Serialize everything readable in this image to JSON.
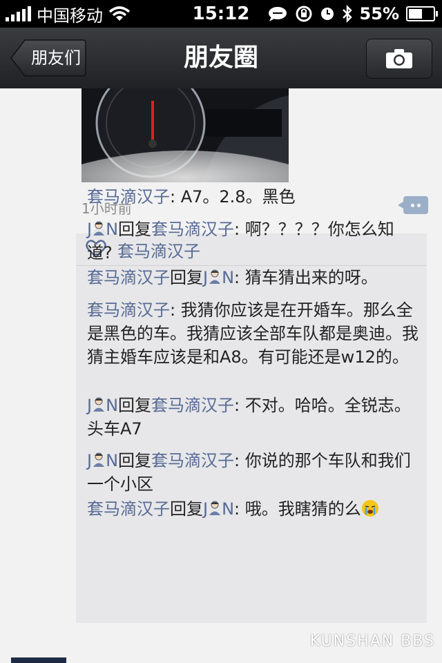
{
  "status_bar": {
    "carrier": "中国移动",
    "time": "15:12",
    "battery_percent": "55%",
    "battery_level": 0.55
  },
  "nav": {
    "back_label": "朋友们",
    "title": "朋友圈"
  },
  "post": {
    "timestamp": "1小时前",
    "likes": [
      "套马滴汉子"
    ]
  },
  "comments": [
    {
      "author": "套马滴汉子",
      "reply_to": "",
      "text": "A7。2.8。黑色"
    },
    {
      "author": "J N",
      "reply_to": "套马滴汉子",
      "text": "啊？？？？你怎么知道?"
    },
    {
      "author": "套马滴汉子",
      "reply_to": "J N",
      "text": "猜车猜出来的呀。"
    },
    {
      "author": "套马滴汉子",
      "reply_to": "",
      "text": "我猜你应该是在开婚车。那么全是黑色的车。我猜应该全部车队都是奥迪。我猜主婚车应该是和A8。有可能还是w12的。"
    },
    {
      "author": "J N",
      "reply_to": "套马滴汉子",
      "text": "不对。哈哈。全锐志。头车A7"
    },
    {
      "author": "J N",
      "reply_to": "套马滴汉子",
      "text": "你说的那个车队和我们一个小区"
    },
    {
      "author": "套马滴汉子",
      "reply_to": "J N",
      "text": "哦。我瞎猜的么"
    }
  ],
  "labels": {
    "reply_word": "回复",
    "colon": ": "
  },
  "watermark": "KUNSHAN BBS",
  "icons": {
    "back": "back-arrow",
    "camera": "camera-icon",
    "like": "heart-icon",
    "comment": "comment-icon"
  },
  "colors": {
    "nickname": "#576b95",
    "navbar": "#2b2d30"
  }
}
